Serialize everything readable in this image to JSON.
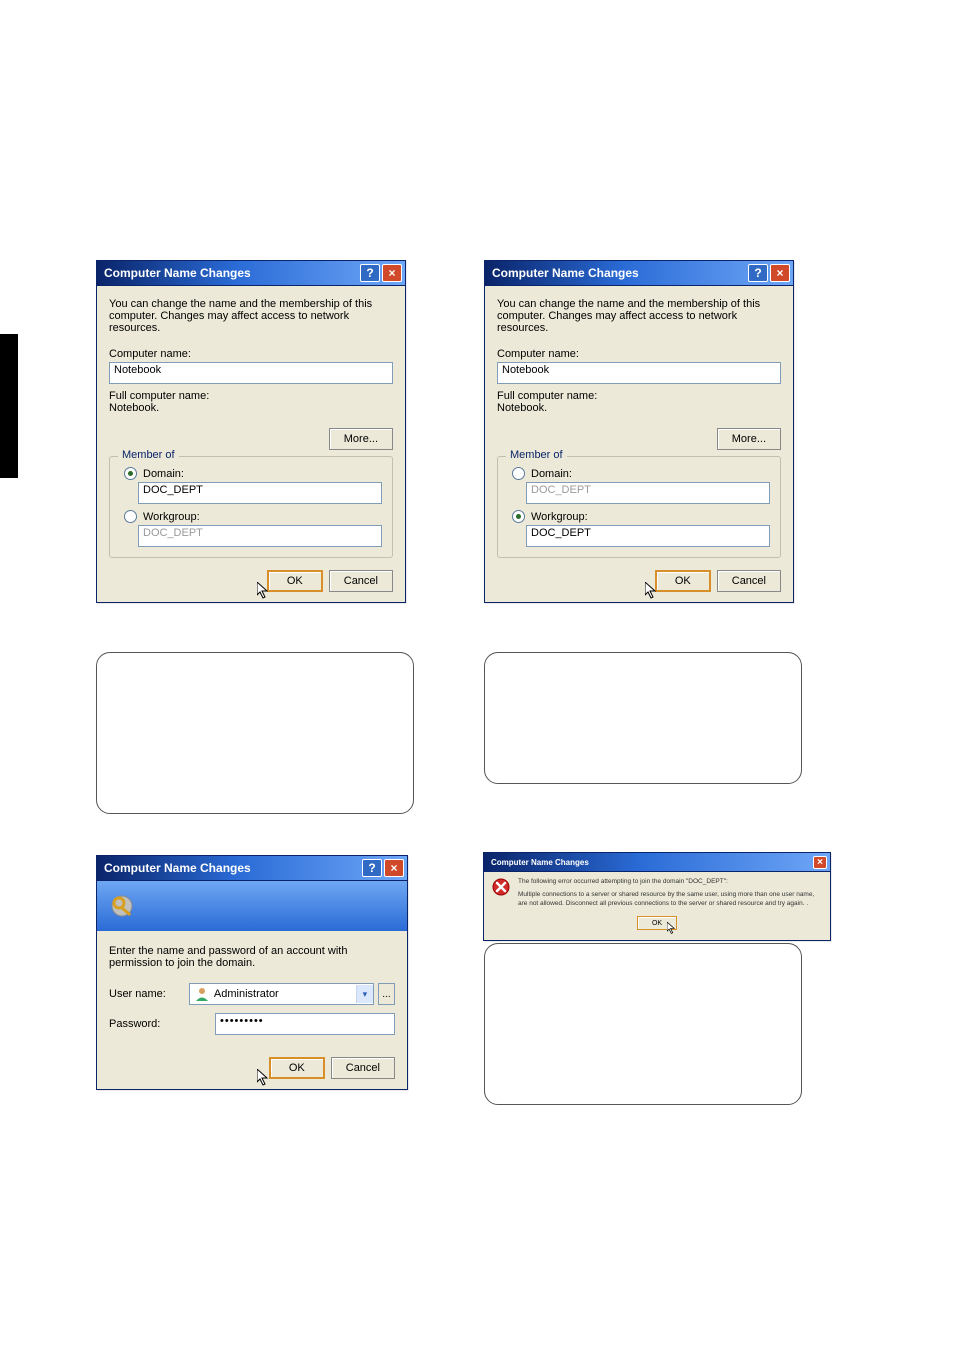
{
  "dlg1": {
    "title": "Computer Name Changes",
    "desc": "You can change the name and the membership of this computer. Changes may affect access to network resources.",
    "computer_name_label": "Computer name:",
    "computer_name_value": "Notebook",
    "full_label": "Full computer name:",
    "full_value": "Notebook.",
    "more_btn": "More...",
    "memberof": "Member of",
    "domain_label": "Domain:",
    "domain_value": "DOC_DEPT",
    "workgroup_label": "Workgroup:",
    "workgroup_value": "DOC_DEPT",
    "ok": "OK",
    "cancel": "Cancel",
    "selected": "domain"
  },
  "dlg2": {
    "title": "Computer Name Changes",
    "desc": "You can change the name and the membership of this computer. Changes may affect access to network resources.",
    "computer_name_label": "Computer name:",
    "computer_name_value": "Notebook",
    "full_label": "Full computer name:",
    "full_value": "Notebook.",
    "more_btn": "More...",
    "memberof": "Member of",
    "domain_label": "Domain:",
    "domain_value": "DOC_DEPT",
    "workgroup_label": "Workgroup:",
    "workgroup_value": "DOC_DEPT",
    "ok": "OK",
    "cancel": "Cancel",
    "selected": "workgroup"
  },
  "dlg3": {
    "title": "Computer Name Changes",
    "instruction": "Enter the name and password of an account with permission to join the domain.",
    "user_label": "User name:",
    "user_value": "Administrator",
    "pass_label": "Password:",
    "pass_value": "•••••••••",
    "browse": "...",
    "ok": "OK",
    "cancel": "Cancel"
  },
  "dlg4": {
    "title": "Computer Name Changes",
    "line1": "The following error occurred attempting to join the domain \"DOC_DEPT\":",
    "line2": "Multiple connections to a server or shared resource by the same user, using more than one user name, are not allowed. Disconnect all previous connections to the server or shared resource and try again. .",
    "ok": "OK"
  }
}
